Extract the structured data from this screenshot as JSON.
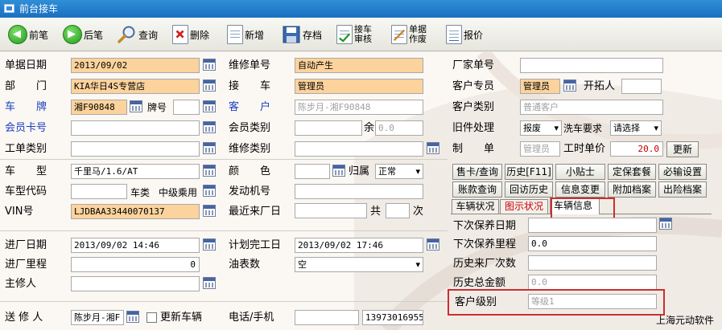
{
  "window": {
    "title": "前台接车"
  },
  "toolbar": {
    "prev": "前笔",
    "next": "后笔",
    "query": "查询",
    "delete": "删除",
    "new": "新增",
    "save": "存档",
    "receive_audit_1": "接车",
    "receive_audit_2": "审核",
    "bill_void_1": "单据",
    "bill_void_2": "作废",
    "quote": "报价"
  },
  "form": {
    "doc_date": {
      "label": "单据日期",
      "value": "2013/09/02"
    },
    "dept": {
      "label": "部　　门",
      "value": "KIA华日4S专营店"
    },
    "plate": {
      "label": "车　　牌",
      "value": "湘F90848"
    },
    "plate_no": {
      "label": "牌号",
      "value": ""
    },
    "member_card": {
      "label": "会员卡号",
      "value": ""
    },
    "work_type": {
      "label": "工单类别",
      "value": ""
    },
    "car_model": {
      "label": "车　　型",
      "value": "千里马/1.6/AT"
    },
    "model_code": {
      "label": "车型代码",
      "value": ""
    },
    "car_class": {
      "label": "车类",
      "value": "中级乘用"
    },
    "vin": {
      "label": "VIN号",
      "value": "LJDBAA33440070137"
    },
    "in_date": {
      "label": "进厂日期",
      "value": "2013/09/02 14:46"
    },
    "in_mileage": {
      "label": "进厂里程",
      "value": "0"
    },
    "chief_repair": {
      "label": "主修人",
      "value": ""
    },
    "sender": {
      "label": "送 修 人",
      "value": "陈步月-湘F"
    },
    "update_vehicle": {
      "label": "更新车辆"
    },
    "repair_no": {
      "label": "维修单号",
      "value": "自动产生"
    },
    "receiver": {
      "label": "接　　车",
      "value": "管理员"
    },
    "customer": {
      "label": "客　　户",
      "value": "陈步月-湘F90848"
    },
    "member_type": {
      "label": "会员类别",
      "value": ""
    },
    "balance": {
      "label": "余",
      "value": "0.0"
    },
    "repair_type": {
      "label": "维修类别",
      "value": ""
    },
    "color": {
      "label": "颜　　色",
      "value": ""
    },
    "belong": {
      "label": "归属",
      "value": "正常"
    },
    "engine_no": {
      "label": "发动机号",
      "value": ""
    },
    "last_visit": {
      "label": "最近来厂日",
      "value": "",
      "total_label": "共",
      "count": "",
      "times_label": "次"
    },
    "plan_done": {
      "label": "计划完工日",
      "value": "2013/09/02 17:46"
    },
    "fuel": {
      "label": "油表数",
      "value": "空"
    },
    "phone": {
      "label": "电话/手机",
      "value": "",
      "mobile": "13973016955"
    },
    "factory_no": {
      "label": "厂家单号",
      "value": ""
    },
    "advisor": {
      "label": "客户专员",
      "value": "管理员"
    },
    "developer": {
      "label": "开拓人",
      "value": ""
    },
    "customer_type": {
      "label": "客户类别",
      "value": "普通客户"
    },
    "old_parts": {
      "label": "旧件处理",
      "value": "报废"
    },
    "wash": {
      "label": "洗车要求",
      "value": "请选择"
    },
    "maker": {
      "label": "制　　单",
      "value": "管理员"
    },
    "hour_price": {
      "label": "工时单价",
      "value": "20.0"
    },
    "refresh": "更新"
  },
  "buttons": {
    "row1": [
      "售卡/查询",
      "历史[F11]",
      "小贴士",
      "定保套餐",
      "必输设置"
    ],
    "row2": [
      "账款查询",
      "回访历史",
      "信息变更",
      "附加档案",
      "出险档案"
    ]
  },
  "tabs": [
    "车辆状况",
    "图示状况",
    "车辆信息"
  ],
  "vehicle_info": {
    "next_maint_date": {
      "label": "下次保养日期",
      "value": ""
    },
    "next_maint_mileage": {
      "label": "下次保养里程",
      "value": "0.0"
    },
    "hist_visits": {
      "label": "历史来厂次数",
      "value": ""
    },
    "hist_total": {
      "label": "历史总金额",
      "value": "0.0"
    },
    "customer_level": {
      "label": "客户级别",
      "value": "等级1"
    }
  },
  "footer": {
    "company": "上海元动软件"
  }
}
